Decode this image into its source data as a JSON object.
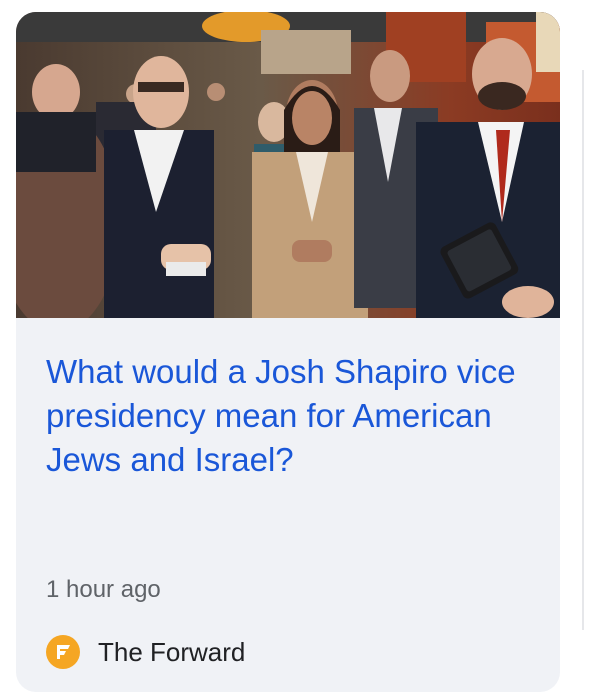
{
  "article": {
    "headline": "What would a Josh Shapiro vice presidency mean for American Jews and Israel?",
    "time": "1 hour ago",
    "source": {
      "name": "The Forward",
      "logo_icon": "forward-f-logo-icon"
    }
  },
  "colors": {
    "card_background": "#f0f2f6",
    "headline": "#1a57d8",
    "meta_text": "#5f6368",
    "source_text": "#202124",
    "logo": "#f5a623"
  }
}
